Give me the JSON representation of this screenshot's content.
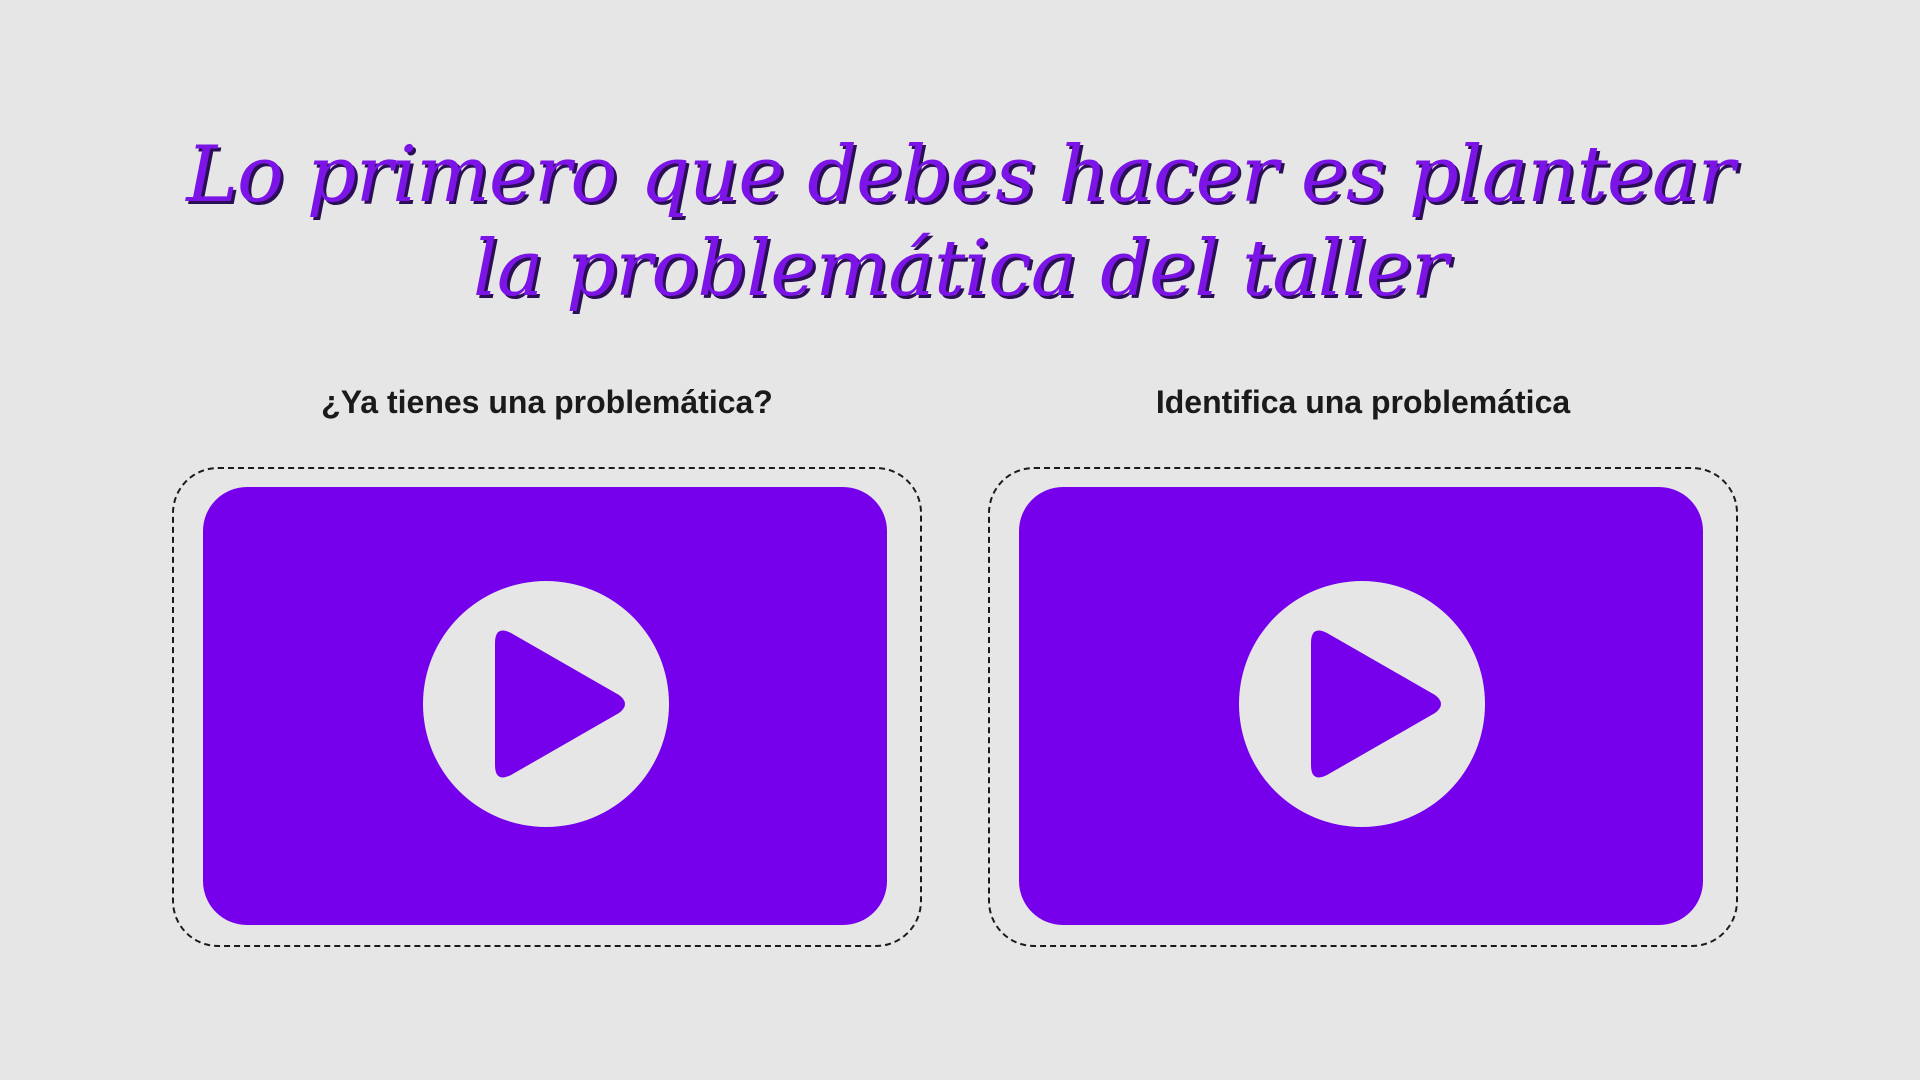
{
  "title": {
    "line1": "Lo primero que debes hacer es plantear",
    "line2": "la problemática del taller"
  },
  "videos": [
    {
      "label": "¿Ya tienes una problemática?",
      "icon": "play-icon"
    },
    {
      "label": "Identifica una problemática",
      "icon": "play-icon"
    }
  ],
  "colors": {
    "background": "#e6e6e6",
    "accent": "#7600eb",
    "title": "#7c14e8",
    "title_shadow": "#2a0f55",
    "play_circle": "#e6e6e6",
    "label": "#1a1a1a"
  }
}
